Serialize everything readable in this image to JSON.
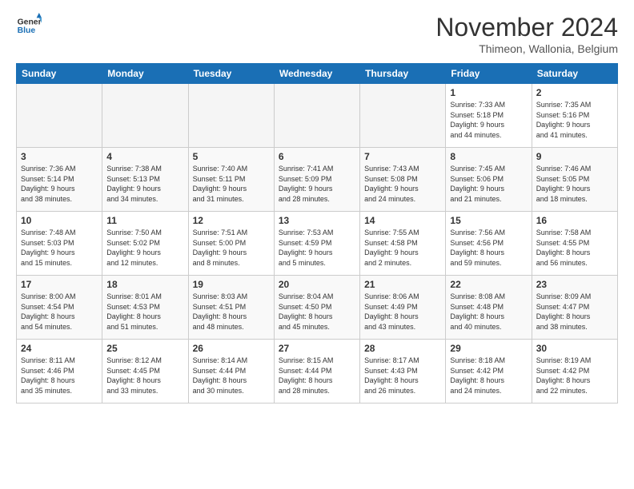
{
  "header": {
    "logo_line1": "General",
    "logo_line2": "Blue",
    "month": "November 2024",
    "location": "Thimeon, Wallonia, Belgium"
  },
  "weekdays": [
    "Sunday",
    "Monday",
    "Tuesday",
    "Wednesday",
    "Thursday",
    "Friday",
    "Saturday"
  ],
  "weeks": [
    [
      {
        "day": "",
        "info": ""
      },
      {
        "day": "",
        "info": ""
      },
      {
        "day": "",
        "info": ""
      },
      {
        "day": "",
        "info": ""
      },
      {
        "day": "",
        "info": ""
      },
      {
        "day": "1",
        "info": "Sunrise: 7:33 AM\nSunset: 5:18 PM\nDaylight: 9 hours\nand 44 minutes."
      },
      {
        "day": "2",
        "info": "Sunrise: 7:35 AM\nSunset: 5:16 PM\nDaylight: 9 hours\nand 41 minutes."
      }
    ],
    [
      {
        "day": "3",
        "info": "Sunrise: 7:36 AM\nSunset: 5:14 PM\nDaylight: 9 hours\nand 38 minutes."
      },
      {
        "day": "4",
        "info": "Sunrise: 7:38 AM\nSunset: 5:13 PM\nDaylight: 9 hours\nand 34 minutes."
      },
      {
        "day": "5",
        "info": "Sunrise: 7:40 AM\nSunset: 5:11 PM\nDaylight: 9 hours\nand 31 minutes."
      },
      {
        "day": "6",
        "info": "Sunrise: 7:41 AM\nSunset: 5:09 PM\nDaylight: 9 hours\nand 28 minutes."
      },
      {
        "day": "7",
        "info": "Sunrise: 7:43 AM\nSunset: 5:08 PM\nDaylight: 9 hours\nand 24 minutes."
      },
      {
        "day": "8",
        "info": "Sunrise: 7:45 AM\nSunset: 5:06 PM\nDaylight: 9 hours\nand 21 minutes."
      },
      {
        "day": "9",
        "info": "Sunrise: 7:46 AM\nSunset: 5:05 PM\nDaylight: 9 hours\nand 18 minutes."
      }
    ],
    [
      {
        "day": "10",
        "info": "Sunrise: 7:48 AM\nSunset: 5:03 PM\nDaylight: 9 hours\nand 15 minutes."
      },
      {
        "day": "11",
        "info": "Sunrise: 7:50 AM\nSunset: 5:02 PM\nDaylight: 9 hours\nand 12 minutes."
      },
      {
        "day": "12",
        "info": "Sunrise: 7:51 AM\nSunset: 5:00 PM\nDaylight: 9 hours\nand 8 minutes."
      },
      {
        "day": "13",
        "info": "Sunrise: 7:53 AM\nSunset: 4:59 PM\nDaylight: 9 hours\nand 5 minutes."
      },
      {
        "day": "14",
        "info": "Sunrise: 7:55 AM\nSunset: 4:58 PM\nDaylight: 9 hours\nand 2 minutes."
      },
      {
        "day": "15",
        "info": "Sunrise: 7:56 AM\nSunset: 4:56 PM\nDaylight: 8 hours\nand 59 minutes."
      },
      {
        "day": "16",
        "info": "Sunrise: 7:58 AM\nSunset: 4:55 PM\nDaylight: 8 hours\nand 56 minutes."
      }
    ],
    [
      {
        "day": "17",
        "info": "Sunrise: 8:00 AM\nSunset: 4:54 PM\nDaylight: 8 hours\nand 54 minutes."
      },
      {
        "day": "18",
        "info": "Sunrise: 8:01 AM\nSunset: 4:53 PM\nDaylight: 8 hours\nand 51 minutes."
      },
      {
        "day": "19",
        "info": "Sunrise: 8:03 AM\nSunset: 4:51 PM\nDaylight: 8 hours\nand 48 minutes."
      },
      {
        "day": "20",
        "info": "Sunrise: 8:04 AM\nSunset: 4:50 PM\nDaylight: 8 hours\nand 45 minutes."
      },
      {
        "day": "21",
        "info": "Sunrise: 8:06 AM\nSunset: 4:49 PM\nDaylight: 8 hours\nand 43 minutes."
      },
      {
        "day": "22",
        "info": "Sunrise: 8:08 AM\nSunset: 4:48 PM\nDaylight: 8 hours\nand 40 minutes."
      },
      {
        "day": "23",
        "info": "Sunrise: 8:09 AM\nSunset: 4:47 PM\nDaylight: 8 hours\nand 38 minutes."
      }
    ],
    [
      {
        "day": "24",
        "info": "Sunrise: 8:11 AM\nSunset: 4:46 PM\nDaylight: 8 hours\nand 35 minutes."
      },
      {
        "day": "25",
        "info": "Sunrise: 8:12 AM\nSunset: 4:45 PM\nDaylight: 8 hours\nand 33 minutes."
      },
      {
        "day": "26",
        "info": "Sunrise: 8:14 AM\nSunset: 4:44 PM\nDaylight: 8 hours\nand 30 minutes."
      },
      {
        "day": "27",
        "info": "Sunrise: 8:15 AM\nSunset: 4:44 PM\nDaylight: 8 hours\nand 28 minutes."
      },
      {
        "day": "28",
        "info": "Sunrise: 8:17 AM\nSunset: 4:43 PM\nDaylight: 8 hours\nand 26 minutes."
      },
      {
        "day": "29",
        "info": "Sunrise: 8:18 AM\nSunset: 4:42 PM\nDaylight: 8 hours\nand 24 minutes."
      },
      {
        "day": "30",
        "info": "Sunrise: 8:19 AM\nSunset: 4:42 PM\nDaylight: 8 hours\nand 22 minutes."
      }
    ]
  ]
}
